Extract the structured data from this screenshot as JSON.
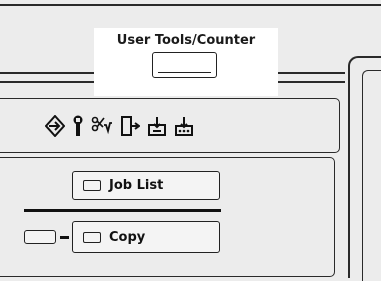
{
  "label": {
    "text": "User Tools/Counter"
  },
  "icons": [
    "enter-icon",
    "wrench-icon",
    "scanner-icon",
    "document-copy-icon",
    "tray-icon",
    "tray-stack-icon"
  ],
  "buttons": {
    "job_list": "Job List",
    "copy": "Copy"
  }
}
